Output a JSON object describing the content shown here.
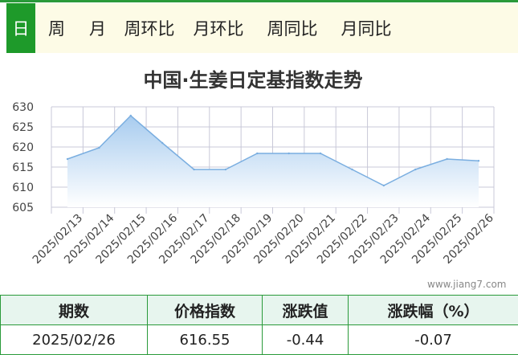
{
  "tabs": [
    {
      "label": "日",
      "active": true
    },
    {
      "label": "周",
      "active": false
    },
    {
      "label": "月",
      "active": false
    },
    {
      "label": "周环比",
      "active": false
    },
    {
      "label": "月环比",
      "active": false
    },
    {
      "label": "周同比",
      "active": false
    },
    {
      "label": "月同比",
      "active": false
    }
  ],
  "chart_title": "中国·生姜日定基指数走势",
  "watermark": "www.jiang7.com",
  "chart_data": {
    "type": "area",
    "title": "中国·生姜日定基指数走势",
    "xlabel": "",
    "ylabel": "",
    "categories": [
      "2025/02/13",
      "2025/02/14",
      "2025/02/15",
      "2025/02/16",
      "2025/02/17",
      "2025/02/18",
      "2025/02/19",
      "2025/02/20",
      "2025/02/21",
      "2025/02/22",
      "2025/02/23",
      "2025/02/24",
      "2025/02/25",
      "2025/02/26"
    ],
    "values": [
      617.0,
      619.8,
      627.8,
      621.0,
      614.4,
      614.4,
      618.4,
      618.4,
      618.4,
      614.4,
      610.4,
      614.4,
      617.0,
      616.55
    ],
    "y_ticks": [
      605,
      610,
      615,
      620,
      625,
      630
    ],
    "ylim": [
      605,
      630
    ],
    "grid": true,
    "colors": {
      "line": "#7aaee0",
      "fill_top": "#a8ccef",
      "fill_bottom": "#ffffff",
      "grid": "#c8c8d8"
    }
  },
  "table": {
    "headers": [
      "期数",
      "价格指数",
      "涨跌值",
      "涨跌幅（%）"
    ],
    "rows": [
      [
        "2025/02/26",
        "616.55",
        "-0.44",
        "-0.07"
      ]
    ]
  },
  "colors": {
    "brand_green": "#1e9a2a",
    "tab_bar_bg": "#fdfbe6",
    "table_header_bg": "#e7f5ee"
  }
}
